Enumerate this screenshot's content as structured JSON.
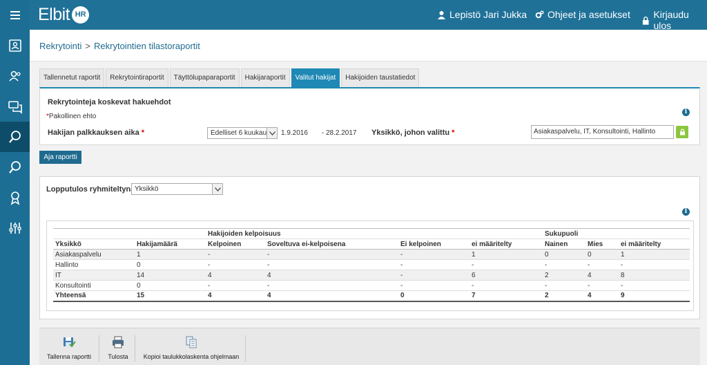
{
  "header": {
    "logo_text": "Elbit",
    "logo_badge": "HR",
    "user_label": "Lepistö Jari Jukka",
    "settings_label": "Ohjeet ja asetukset",
    "logout_label": "Kirjaudu ulos"
  },
  "sidebar": {
    "icons": [
      "menu-icon",
      "profile-card-icon",
      "users-icon",
      "chat-icon",
      "search-report-icon",
      "search-icon",
      "award-icon",
      "sliders-icon"
    ]
  },
  "breadcrumb": {
    "parent": "Rekrytointi",
    "separator": ">",
    "current": "Rekrytointien tilastoraportit"
  },
  "tabs": [
    {
      "label": "Tallennetut raportit",
      "active": false
    },
    {
      "label": "Rekrytointiraportit",
      "active": false
    },
    {
      "label": "Täyttölupaparaportit",
      "active": false
    },
    {
      "label": "Hakijaraportit",
      "active": false
    },
    {
      "label": "Valitut hakijat",
      "active": true
    },
    {
      "label": "Hakijoiden taustatiedot",
      "active": false
    }
  ],
  "criteria": {
    "title": "Rekrytointeja koskevat hakuehdot",
    "required_mark": "*",
    "required_note": "Pakollinen ehto",
    "hire_time_label": "Hakijan palkkauksen aika",
    "hire_time_select": "Edelliset 6 kuukautta",
    "date_from": "1.9.2016",
    "date_dash": "-",
    "date_to": "28.2.2017",
    "unit_label": "Yksikkö, johon valittu",
    "unit_value": "Asiakaspalvelu, IT, Konsultointi, Hallinto"
  },
  "run_button": "Aja raportti",
  "results": {
    "group_by_label": "Lopputulos ryhmiteltynä",
    "group_by_value": "Yksikkö",
    "group_headers": {
      "eligibility": "Hakijoiden kelpoisuus",
      "gender": "Sukupuoli"
    },
    "columns": [
      "Yksikkö",
      "Hakijamäärä",
      "Kelpoinen",
      "Soveltuva ei-kelpoisena",
      "Ei kelpoinen",
      "ei määritelty",
      "Nainen",
      "Mies",
      "ei määritelty"
    ],
    "rows": [
      [
        "Asiakaspalvelu",
        "1",
        "-",
        "-",
        "-",
        "1",
        "0",
        "0",
        "1"
      ],
      [
        "Hallinto",
        "0",
        "-",
        "-",
        "-",
        "-",
        "-",
        "-",
        "-"
      ],
      [
        "IT",
        "14",
        "4",
        "4",
        "-",
        "6",
        "2",
        "4",
        "8"
      ],
      [
        "Konsultointi",
        "0",
        "-",
        "-",
        "-",
        "-",
        "-",
        "-",
        "-"
      ]
    ],
    "total": [
      "Yhteensä",
      "15",
      "4",
      "4",
      "0",
      "7",
      "2",
      "4",
      "9"
    ]
  },
  "toolbar": {
    "save_label": "Tallenna raportti",
    "print_label": "Tulosta",
    "copy_label": "Kopioi taulukkolaskenta ohjelmaan"
  },
  "colors": {
    "brand": "#1f7198",
    "active_tab": "#1f88b5",
    "lock_green": "#8cc63f"
  }
}
